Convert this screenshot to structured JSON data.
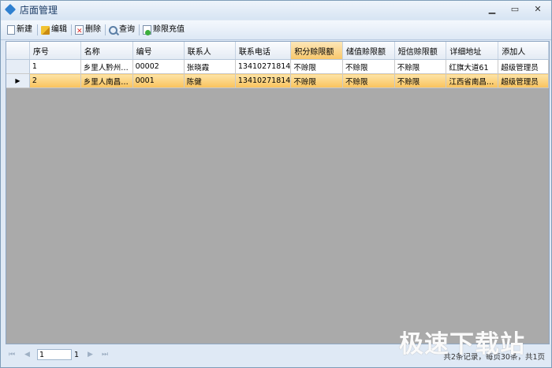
{
  "window": {
    "title": "店面管理",
    "min": "▁",
    "max": "▭",
    "close": "✕"
  },
  "toolbar": {
    "new": "新建",
    "edit": "编辑",
    "delete": "删除",
    "query": "查询",
    "charge": "赊限充值"
  },
  "grid": {
    "columns": [
      "序号",
      "名称",
      "编号",
      "联系人",
      "联系电话",
      "积分赊限额",
      "储值赊限额",
      "短信赊限额",
      "详细地址",
      "添加人"
    ],
    "rows": [
      [
        "1",
        "乡里人黔州…",
        "00002",
        "张晓霞",
        "13410271814",
        "不赊限",
        "不赊限",
        "不赊限",
        "红旗大道61",
        "超级管理员"
      ],
      [
        "2",
        "乡里人南昌…",
        "0001",
        "陈健",
        "13410271814",
        "不赊限",
        "不赊限",
        "不赊限",
        "江西省南昌…",
        "超级管理员"
      ]
    ],
    "selected_indicator": "▶"
  },
  "pager": {
    "first": "⏮",
    "prev": "◀",
    "page": "1",
    "total_pages": "1",
    "next": "▶",
    "last": "⏭",
    "info": "共2条记录，每页30条，共1页"
  },
  "watermark": "极速下载站"
}
